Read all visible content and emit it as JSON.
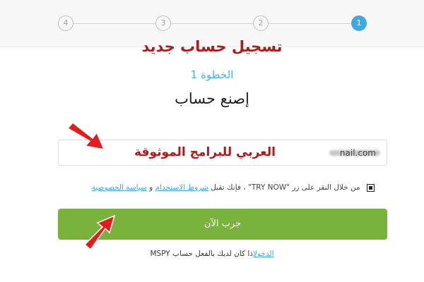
{
  "stepper": {
    "steps": [
      {
        "label": "4",
        "state": "inactive"
      },
      {
        "label": "3",
        "state": "inactive"
      },
      {
        "label": "2",
        "state": "inactive"
      },
      {
        "label": "1",
        "state": "active"
      }
    ],
    "active_color": "#3fa9e0"
  },
  "annotation": {
    "title": "تسجيل حساب جديد",
    "overlay": "العربي للبرامج الموثوقة",
    "color": "#b11818"
  },
  "form": {
    "step_label": "الخطوة 1",
    "heading": "إصنع حساب",
    "email_value_visible": "nail.com",
    "terms": {
      "prefix": "من خلال النقر على زر \"TRY NOW\" ، فإنك تقبل",
      "terms_link": "شروط الاستخدام",
      "and": "و",
      "privacy_link": "سياسة الخصوصية",
      "checked": true
    },
    "submit_label": "جرب الآن",
    "submit_color": "#7ab33b",
    "login_text": "إذا كان لديك بالفعل حساب MSPY",
    "login_link": "الدخول"
  }
}
